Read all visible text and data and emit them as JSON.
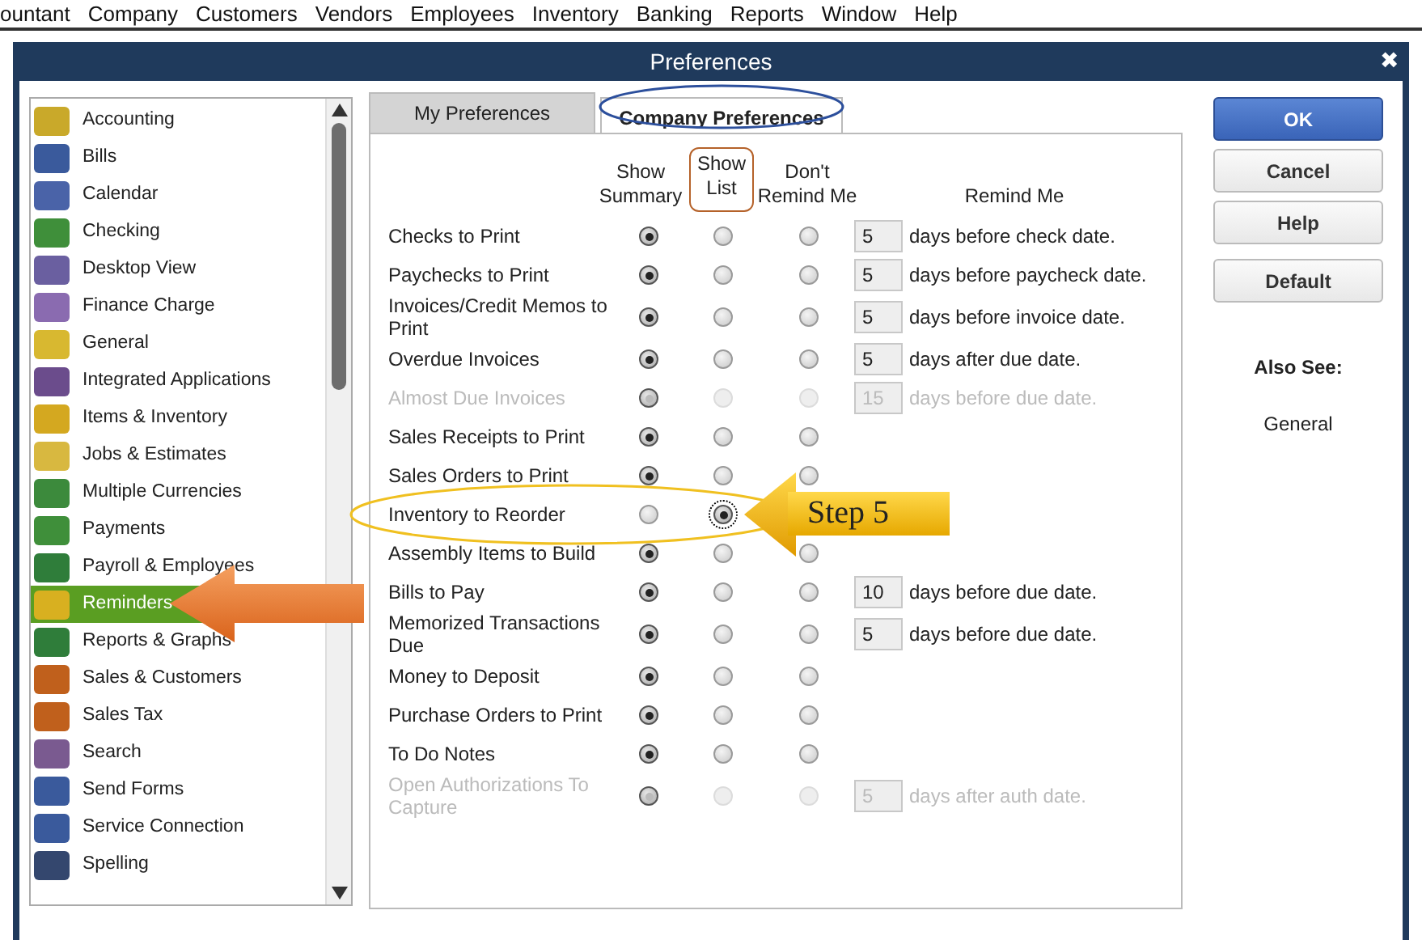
{
  "menu_bar": [
    "ountant",
    "Company",
    "Customers",
    "Vendors",
    "Employees",
    "Inventory",
    "Banking",
    "Reports",
    "Window",
    "Help"
  ],
  "window": {
    "title": "Preferences",
    "close": "✖"
  },
  "sidebar": {
    "items": [
      {
        "label": "Accounting",
        "selected": false,
        "color": "#c9a92a"
      },
      {
        "label": "Bills",
        "selected": false,
        "color": "#3a5a9c"
      },
      {
        "label": "Calendar",
        "selected": false,
        "color": "#4a63a8"
      },
      {
        "label": "Checking",
        "selected": false,
        "color": "#3f8f3a"
      },
      {
        "label": "Desktop View",
        "selected": false,
        "color": "#6a5fa0"
      },
      {
        "label": "Finance Charge",
        "selected": false,
        "color": "#8a6bb0"
      },
      {
        "label": "General",
        "selected": false,
        "color": "#d8b830"
      },
      {
        "label": "Integrated Applications",
        "selected": false,
        "color": "#6b4c8c"
      },
      {
        "label": "Items & Inventory",
        "selected": false,
        "color": "#d4a820"
      },
      {
        "label": "Jobs & Estimates",
        "selected": false,
        "color": "#d8b840"
      },
      {
        "label": "Multiple Currencies",
        "selected": false,
        "color": "#3c8a3c"
      },
      {
        "label": "Payments",
        "selected": false,
        "color": "#3f8f3a"
      },
      {
        "label": "Payroll & Employees",
        "selected": false,
        "color": "#2f7d3a"
      },
      {
        "label": "Reminders",
        "selected": true,
        "color": "#d8b020"
      },
      {
        "label": "Reports & Graphs",
        "selected": false,
        "color": "#2f7d3a"
      },
      {
        "label": "Sales & Customers",
        "selected": false,
        "color": "#c0601c"
      },
      {
        "label": "Sales Tax",
        "selected": false,
        "color": "#c0601c"
      },
      {
        "label": "Search",
        "selected": false,
        "color": "#7a5a90"
      },
      {
        "label": "Send Forms",
        "selected": false,
        "color": "#3a5a9c"
      },
      {
        "label": "Service Connection",
        "selected": false,
        "color": "#3a5a9c"
      },
      {
        "label": "Spelling",
        "selected": false,
        "color": "#34476e"
      }
    ]
  },
  "tabs": [
    {
      "label": "My Preferences",
      "selected": false
    },
    {
      "label": "Company Preferences",
      "selected": true
    }
  ],
  "reminders": {
    "columns": [
      {
        "label": "Show Summary",
        "highlighted": false
      },
      {
        "label": "Show List",
        "highlighted": true
      },
      {
        "label": "Don't Remind Me",
        "highlighted": false
      },
      {
        "label": "Remind Me",
        "highlighted": false
      }
    ],
    "rows": [
      {
        "label": "Checks to Print",
        "options": [
          {
            "selected": true
          },
          {
            "selected": false
          },
          {
            "selected": false
          }
        ],
        "disabled": false,
        "days": "5",
        "note": "days before check date."
      },
      {
        "label": "Paychecks to Print",
        "options": [
          {
            "selected": true
          },
          {
            "selected": false
          },
          {
            "selected": false
          }
        ],
        "disabled": false,
        "days": "5",
        "note": "days before paycheck date."
      },
      {
        "label": "Invoices/Credit Memos to Print",
        "options": [
          {
            "selected": true
          },
          {
            "selected": false
          },
          {
            "selected": false
          }
        ],
        "disabled": false,
        "days": "5",
        "note": "days before invoice date."
      },
      {
        "label": "Overdue Invoices",
        "options": [
          {
            "selected": true
          },
          {
            "selected": false
          },
          {
            "selected": false
          }
        ],
        "disabled": false,
        "days": "5",
        "note": "days after due date."
      },
      {
        "label": "Almost Due Invoices",
        "options": [
          {
            "selected": true
          },
          {
            "selected": false
          },
          {
            "selected": false
          }
        ],
        "disabled": true,
        "days": "15",
        "note": "days before due date."
      },
      {
        "label": "Sales Receipts to Print",
        "options": [
          {
            "selected": true
          },
          {
            "selected": false
          },
          {
            "selected": false
          }
        ],
        "disabled": false
      },
      {
        "label": "Sales Orders to Print",
        "options": [
          {
            "selected": true
          },
          {
            "selected": false
          },
          {
            "selected": false
          }
        ],
        "disabled": false
      },
      {
        "label": "Inventory to Reorder",
        "options": [
          {
            "selected": false
          },
          {
            "selected": true
          }
        ],
        "disabled": false
      },
      {
        "label": "Assembly Items to Build",
        "options": [
          {
            "selected": true
          },
          {
            "selected": false
          },
          {
            "selected": false
          }
        ],
        "disabled": false
      },
      {
        "label": "Bills to Pay",
        "options": [
          {
            "selected": true
          },
          {
            "selected": false
          },
          {
            "selected": false
          }
        ],
        "disabled": false,
        "days": "10",
        "note": "days before due date."
      },
      {
        "label": "Memorized Transactions Due",
        "options": [
          {
            "selected": true
          },
          {
            "selected": false
          },
          {
            "selected": false
          }
        ],
        "disabled": false,
        "days": "5",
        "note": "days before due date."
      },
      {
        "label": "Money to Deposit",
        "options": [
          {
            "selected": true
          },
          {
            "selected": false
          },
          {
            "selected": false
          }
        ],
        "disabled": false
      },
      {
        "label": "Purchase Orders to Print",
        "options": [
          {
            "selected": true
          },
          {
            "selected": false
          },
          {
            "selected": false
          }
        ],
        "disabled": false
      },
      {
        "label": "To Do Notes",
        "options": [
          {
            "selected": true
          },
          {
            "selected": false
          },
          {
            "selected": false
          }
        ],
        "disabled": false
      },
      {
        "label": "Open Authorizations To Capture",
        "options": [
          {
            "selected": true
          },
          {
            "selected": false
          },
          {
            "selected": false
          }
        ],
        "disabled": true,
        "days": "5",
        "note": "days after auth date."
      }
    ]
  },
  "buttons": [
    {
      "label": "OK",
      "primary": true
    },
    {
      "label": "Cancel",
      "primary": false
    },
    {
      "label": "Help",
      "primary": false
    },
    {
      "label": "Default",
      "primary": false
    }
  ],
  "also_see": {
    "title": "Also See:",
    "links": [
      "General"
    ]
  },
  "annotations": {
    "step_label": "Step 5"
  }
}
